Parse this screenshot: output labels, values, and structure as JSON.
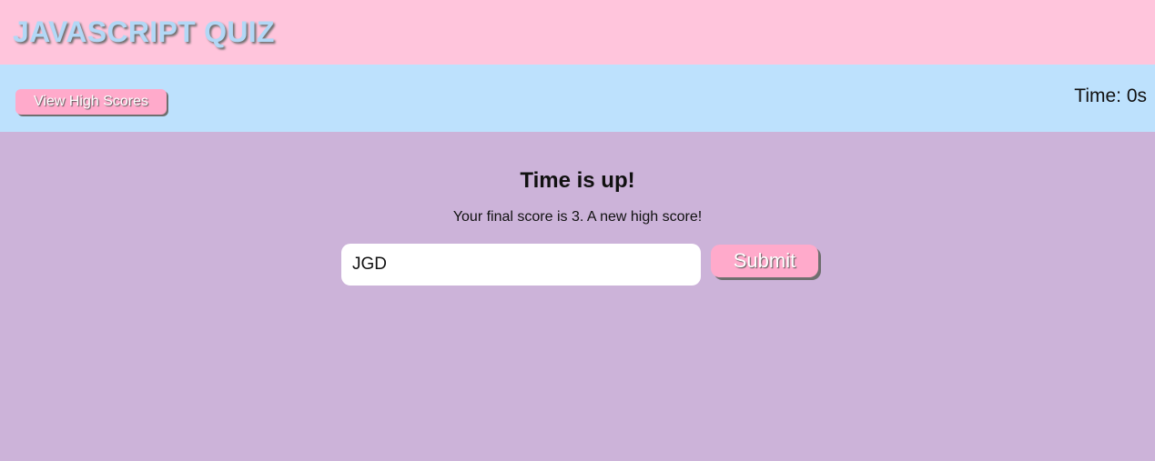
{
  "header": {
    "title": "JAVASCRIPT QUIZ"
  },
  "nav": {
    "high_scores_label": "View High Scores",
    "timer_text": "Time: 0s"
  },
  "result": {
    "title": "Time is up!",
    "message": "Your final score is 3. A new high score!"
  },
  "form": {
    "initials_value": "JGD",
    "submit_label": "Submit"
  },
  "colors": {
    "header_bg": "#ffc5dc",
    "nav_bg": "#bde1fd",
    "main_bg": "#ccb3d9",
    "button_bg": "#ffaacb",
    "title_text": "#b2d8f6"
  }
}
